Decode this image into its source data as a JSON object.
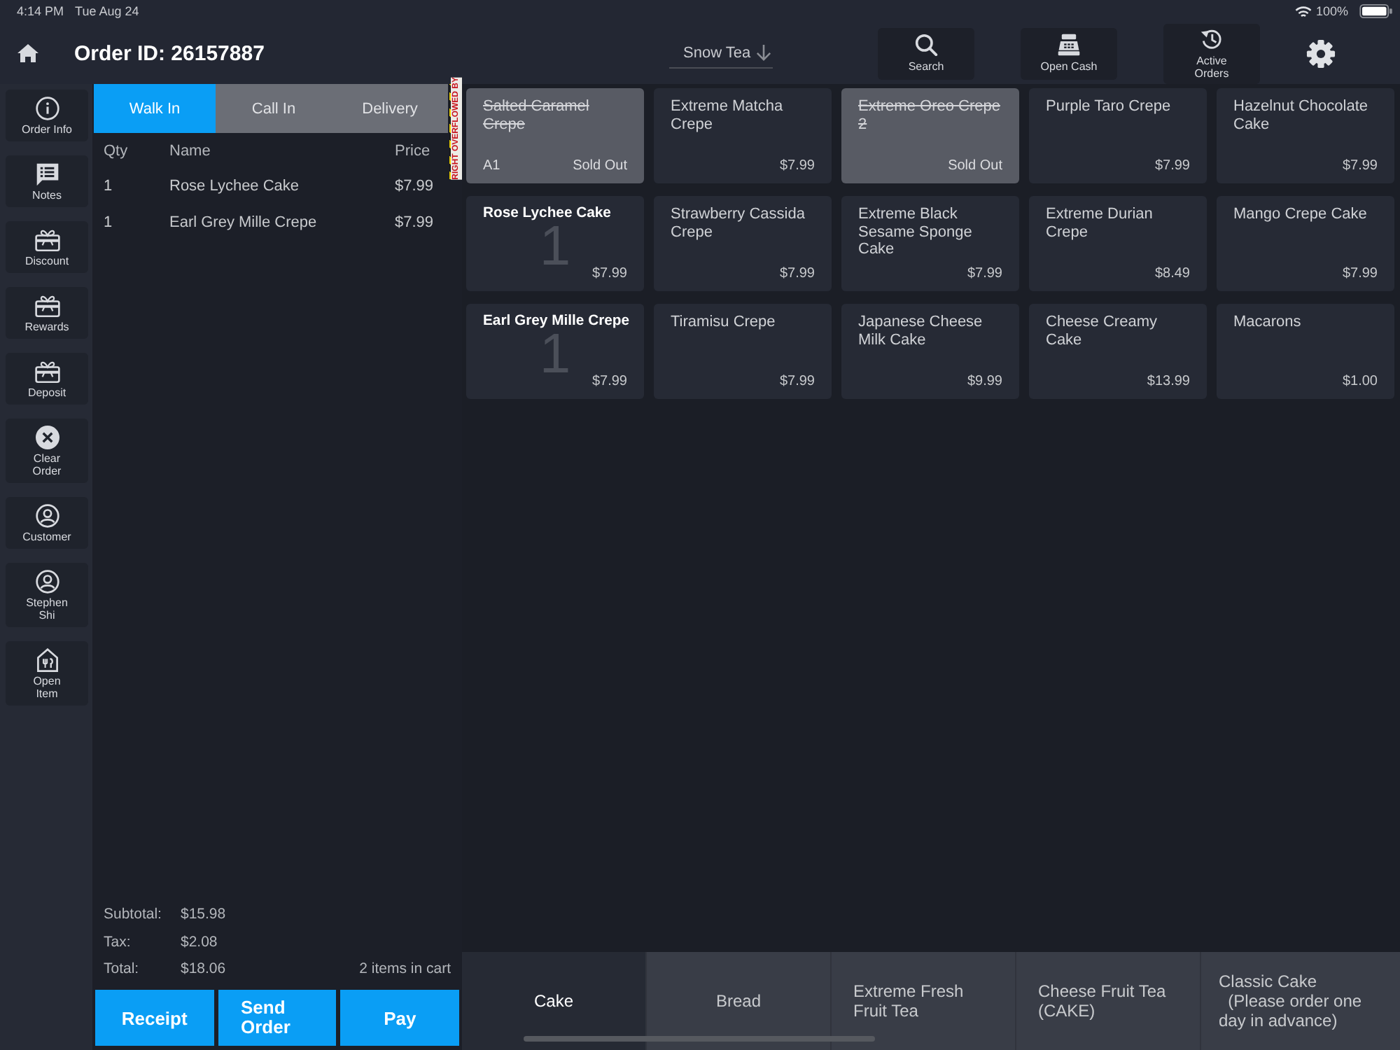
{
  "status_bar": {
    "time": "4:14 PM",
    "date": "Tue Aug 24",
    "battery": "100%"
  },
  "header": {
    "order_id": "Order ID: 26157887",
    "store": "Snow Tea",
    "tools": [
      {
        "label": "Search"
      },
      {
        "label": "Open Cash"
      },
      {
        "label": "Active Orders"
      }
    ]
  },
  "sidebar": {
    "items": [
      {
        "label": "Order Info"
      },
      {
        "label": "Notes"
      },
      {
        "label": "Discount"
      },
      {
        "label": "Rewards"
      },
      {
        "label": "Deposit"
      },
      {
        "label": "Clear\nOrder"
      },
      {
        "label": "Customer"
      },
      {
        "label": "Stephen\nShi"
      },
      {
        "label": "Open\nItem"
      }
    ]
  },
  "order_types": [
    {
      "label": "Walk In",
      "selected": true
    },
    {
      "label": "Call In",
      "selected": false
    },
    {
      "label": "Delivery",
      "selected": false
    }
  ],
  "overflow_warning": "RIGHT OVERFLOWED BY",
  "cart": {
    "columns": [
      "Qty",
      "Name",
      "Price"
    ],
    "rows": [
      {
        "qty": "1",
        "name": "Rose Lychee Cake",
        "price": "$7.99"
      },
      {
        "qty": "1",
        "name": "Earl Grey Mille Crepe",
        "price": "$7.99"
      }
    ]
  },
  "totals": [
    {
      "label": "Subtotal:",
      "value": "$15.98"
    },
    {
      "label": "Tax:",
      "value": "$2.08"
    },
    {
      "label": "Total:",
      "value": "$18.06"
    }
  ],
  "item_count": "2 items in cart",
  "actions": [
    "Receipt",
    "Send Order",
    "Pay"
  ],
  "products": [
    {
      "name": "Salted Caramel Crepe",
      "code": "A1",
      "status": "Sold Out",
      "sold_out": true,
      "in_cart": false
    },
    {
      "name": "Extreme Matcha Crepe",
      "price": "$7.99",
      "sold_out": false,
      "in_cart": false
    },
    {
      "name": "Extreme Oreo Crepe 2",
      "status": "Sold Out",
      "sold_out": true,
      "in_cart": false
    },
    {
      "name": "Purple Taro Crepe",
      "price": "$7.99",
      "sold_out": false,
      "in_cart": false
    },
    {
      "name": "Hazelnut Chocolate Cake",
      "price": "$7.99",
      "sold_out": false,
      "in_cart": false
    },
    {
      "name": "Rose Lychee Cake",
      "price": "$7.99",
      "quantity": "1",
      "sold_out": false,
      "in_cart": true
    },
    {
      "name": "Strawberry Cassida Crepe",
      "price": "$7.99",
      "sold_out": false,
      "in_cart": false
    },
    {
      "name": "Extreme Black Sesame Sponge Cake",
      "price": "$7.99",
      "sold_out": false,
      "in_cart": false
    },
    {
      "name": "Extreme Durian Crepe",
      "price": "$8.49",
      "sold_out": false,
      "in_cart": false
    },
    {
      "name": "Mango Crepe Cake",
      "price": "$7.99",
      "sold_out": false,
      "in_cart": false
    },
    {
      "name": "Earl Grey Mille Crepe",
      "price": "$7.99",
      "quantity": "1",
      "sold_out": false,
      "in_cart": true
    },
    {
      "name": "Tiramisu Crepe",
      "price": "$7.99",
      "sold_out": false,
      "in_cart": false
    },
    {
      "name": "Japanese Cheese Milk Cake",
      "price": "$9.99",
      "sold_out": false,
      "in_cart": false
    },
    {
      "name": "Cheese Creamy Cake",
      "price": "$13.99",
      "sold_out": false,
      "in_cart": false
    },
    {
      "name": "Macarons",
      "price": "$1.00",
      "sold_out": false,
      "in_cart": false
    }
  ],
  "categories": [
    {
      "label": "Cake",
      "selected": true
    },
    {
      "label": "Bread",
      "selected": false
    },
    {
      "label": "Extreme Fresh Fruit Tea",
      "selected": false
    },
    {
      "label": "Cheese Fruit Tea (CAKE)",
      "selected": false
    },
    {
      "label": "Classic Cake\n  (Please order one day in advance)",
      "selected": false
    }
  ]
}
